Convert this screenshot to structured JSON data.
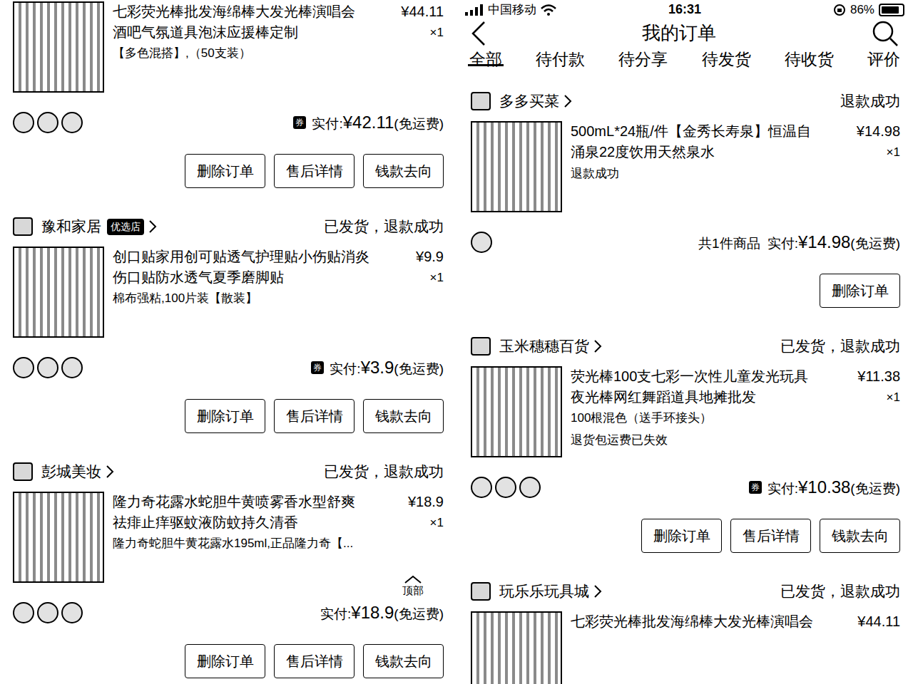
{
  "left": {
    "orders": [
      {
        "shop": null,
        "status": null,
        "product": {
          "title_lines": [
            "七彩荧光棒批发海绵棒大发光棒演唱会",
            "酒吧气氛道具泡沫应援棒定制"
          ],
          "price": "¥44.11",
          "qty": "×1",
          "spec": "【多色混搭】,（50支装）",
          "note": null
        },
        "footer": {
          "avatars": 3,
          "coupon": "券",
          "count_text": null,
          "paid_label": "实付:",
          "paid": "¥42.11",
          "shipping": "(免运费)"
        },
        "buttons": [
          "删除订单",
          "售后详情",
          "钱款去向"
        ]
      },
      {
        "shop": {
          "name": "豫和家居",
          "badge": "优选店"
        },
        "status": "已发货，退款成功",
        "product": {
          "title_lines": [
            "创口贴家用创可贴透气护理贴小伤贴消炎",
            "伤口贴防水透气夏季磨脚贴"
          ],
          "price": "¥9.9",
          "qty": "×1",
          "spec": "棉布强粘,100片装【散装】",
          "note": null
        },
        "footer": {
          "avatars": 3,
          "coupon": "券",
          "count_text": null,
          "paid_label": "实付:",
          "paid": "¥3.9",
          "shipping": "(免运费)"
        },
        "buttons": [
          "删除订单",
          "售后详情",
          "钱款去向"
        ]
      },
      {
        "shop": {
          "name": "彭城美妆",
          "badge": null
        },
        "status": "已发货，退款成功",
        "product": {
          "title_lines": [
            "隆力奇花露水蛇胆牛黄喷雾香水型舒爽",
            "祛痱止痒驱蚊液防蚊持久清香"
          ],
          "price": "¥18.9",
          "qty": "×1",
          "spec": "隆力奇蛇胆牛黄花露水195ml,正品隆力奇【...",
          "note": null
        },
        "footer": {
          "avatars": 3,
          "coupon": null,
          "count_text": null,
          "paid_label": "实付:",
          "paid": "¥18.9",
          "shipping": "(免运费)"
        },
        "buttons": [
          "删除订单",
          "售后详情",
          "钱款去向"
        ]
      }
    ],
    "back_to_top": {
      "label": "顶部"
    }
  },
  "right": {
    "status_bar": {
      "carrier": "中国移动",
      "time": "16:31",
      "battery": "86%",
      "battery_level": 0.86
    },
    "header": {
      "title": "我的订单"
    },
    "tabs": [
      {
        "label": "全部",
        "selected": true
      },
      {
        "label": "待付款",
        "selected": false
      },
      {
        "label": "待分享",
        "selected": false
      },
      {
        "label": "待发货",
        "selected": false
      },
      {
        "label": "待收货",
        "selected": false
      },
      {
        "label": "评价",
        "selected": false
      }
    ],
    "orders": [
      {
        "shop": {
          "name": "多多买菜",
          "badge": null
        },
        "status": "退款成功",
        "product": {
          "title_lines": [
            "500mL*24瓶/件【金秀长寿泉】恒温自",
            "涌泉22度饮用天然泉水"
          ],
          "price": "¥14.98",
          "qty": "×1",
          "spec": null,
          "note": "退款成功"
        },
        "footer": {
          "avatars": 1,
          "coupon": null,
          "count_text": "共1件商品",
          "paid_label": "实付:",
          "paid": "¥14.98",
          "shipping": "(免运费)"
        },
        "buttons": [
          "删除订单"
        ]
      },
      {
        "shop": {
          "name": "玉米穗穗百货",
          "badge": null
        },
        "status": "已发货，退款成功",
        "product": {
          "title_lines": [
            "荧光棒100支七彩一次性儿童发光玩具",
            "夜光棒网红舞蹈道具地摊批发"
          ],
          "price": "¥11.38",
          "qty": "×1",
          "spec": "100根混色（送手环接头）",
          "note": "退货包运费已失效"
        },
        "footer": {
          "avatars": 3,
          "coupon": "券",
          "count_text": null,
          "paid_label": "实付:",
          "paid": "¥10.38",
          "shipping": "(免运费)"
        },
        "buttons": [
          "删除订单",
          "售后详情",
          "钱款去向"
        ]
      },
      {
        "shop": {
          "name": "玩乐乐玩具城",
          "badge": null
        },
        "status": "已发货，退款成功",
        "product": {
          "title_lines": [
            "七彩荧光棒批发海绵棒大发光棒演唱会"
          ],
          "price": "¥44.11",
          "qty": null,
          "spec": null,
          "note": null
        },
        "footer": null,
        "buttons": []
      }
    ]
  }
}
